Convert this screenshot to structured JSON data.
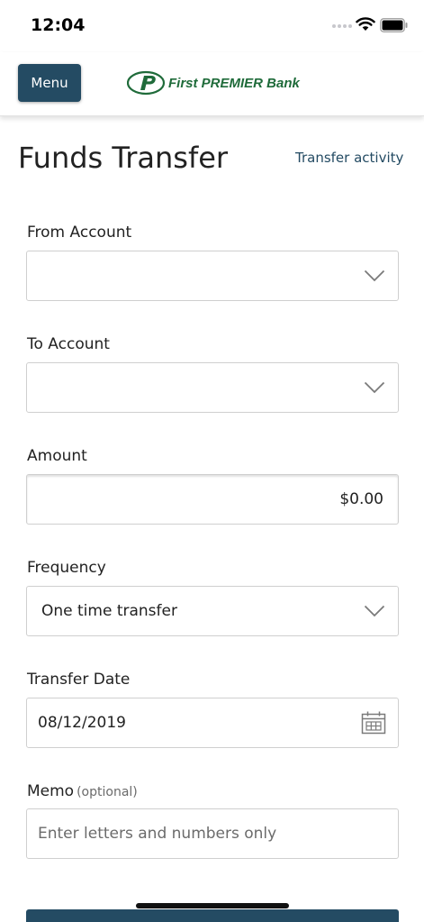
{
  "status_bar": {
    "time": "12:04"
  },
  "header": {
    "menu_label": "Menu",
    "bank_name": "First PREMIER Bank",
    "brand_color": "#1f6b3a",
    "accent_color": "#244b63"
  },
  "page": {
    "title": "Funds Transfer",
    "activity_link": "Transfer activity"
  },
  "form": {
    "from_account": {
      "label": "From Account",
      "value": ""
    },
    "to_account": {
      "label": "To Account",
      "value": ""
    },
    "amount": {
      "label": "Amount",
      "value": "$0.00"
    },
    "frequency": {
      "label": "Frequency",
      "value": "One time transfer"
    },
    "transfer_date": {
      "label": "Transfer Date",
      "value": "08/12/2019"
    },
    "memo": {
      "label": "Memo",
      "optional": "(optional)",
      "placeholder": "Enter letters and numbers only"
    }
  }
}
